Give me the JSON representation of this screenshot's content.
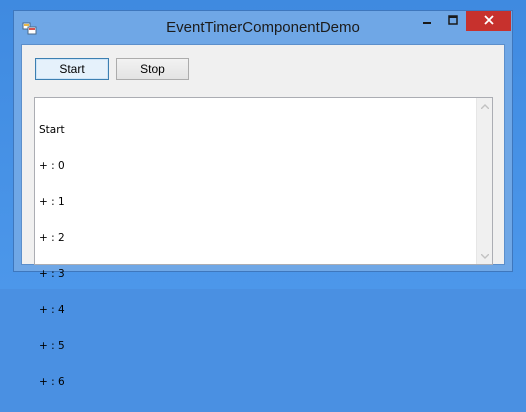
{
  "window": {
    "title": "EventTimerComponentDemo",
    "icon": "app-window-icon",
    "controls": {
      "minimize_icon": "minimize-icon",
      "maximize_icon": "maximize-icon",
      "close_icon": "close-icon"
    }
  },
  "toolbar": {
    "start_label": "Start",
    "stop_label": "Stop"
  },
  "log": {
    "lines": [
      "Start",
      "+ : 0",
      "+ : 1",
      "+ : 2",
      "+ : 3",
      "+ : 4",
      "+ : 5",
      "+ : 6"
    ]
  },
  "colors": {
    "desktop": "#4a90e2",
    "titlebar": "#6fa7e6",
    "close_button": "#c7312d",
    "client_background": "#f0f0f0"
  }
}
